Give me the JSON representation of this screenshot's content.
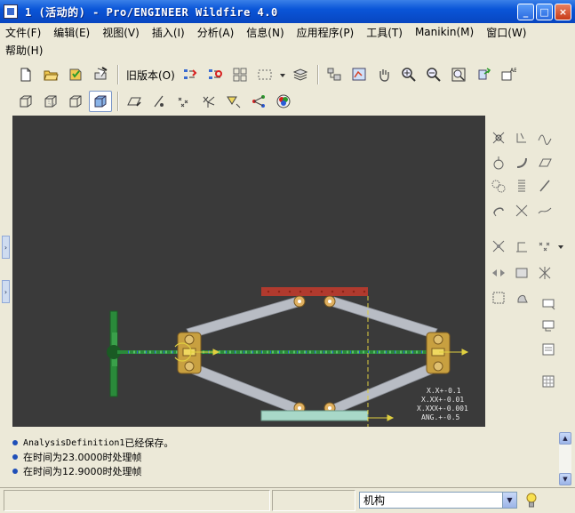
{
  "window": {
    "title": "1 (活动的) - Pro/ENGINEER Wildfire 4.0",
    "min_glyph": "_",
    "max_glyph": "□",
    "close_glyph": "×"
  },
  "menu": {
    "row1": [
      "文件(F)",
      "编辑(E)",
      "视图(V)",
      "插入(I)",
      "分析(A)",
      "信息(N)",
      "应用程序(P)",
      "工具(T)",
      "Manikin(M)",
      "窗口(W)"
    ],
    "row2": [
      "帮助(H)"
    ]
  },
  "toolbar": {
    "old_version_label": "旧版本(O)"
  },
  "viewport": {
    "background": "#3a3a3a",
    "tolerance_lines": [
      "X.X+-0.1",
      "X.XX+-0.01",
      "X.XXX+-0.001",
      "ANG.+-0.5"
    ]
  },
  "messages": [
    {
      "prefix": "AnalysisDefinition1",
      "text": " 已经保存。"
    },
    {
      "prefix": "",
      "text": "在时间为23.0000时处理帧"
    },
    {
      "prefix": "",
      "text": "在时间为12.9000时处理帧"
    }
  ],
  "status": {
    "mode_selected": "机构"
  },
  "colors": {
    "titlebar": "#0a55d8",
    "top_plate": "#b03a2e",
    "bottom_plate": "#a8d8c8",
    "arms": "#b8bcc4",
    "screw": "#2a8a3a",
    "joint": "#c8a040",
    "guide_line": "#e0d040"
  }
}
